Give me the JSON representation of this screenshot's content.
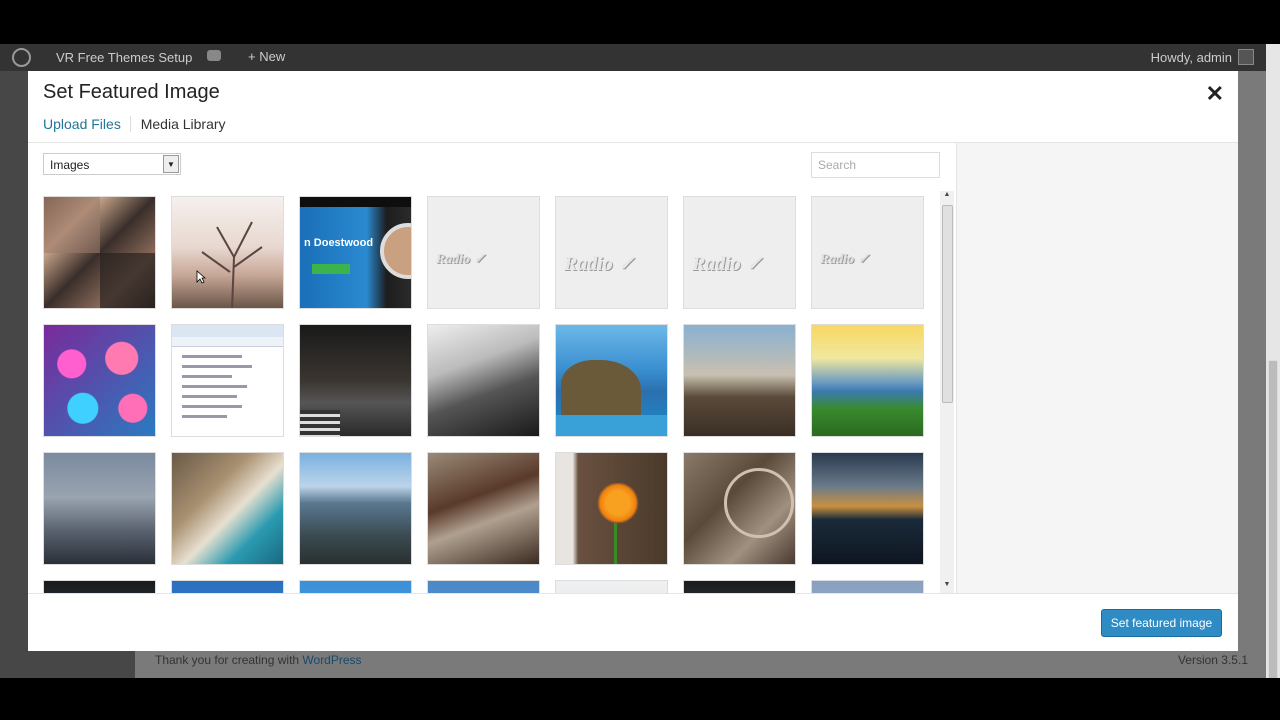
{
  "adminbar": {
    "site_name": "VR Free Themes Setup",
    "new_label": "+ New",
    "howdy": "Howdy, admin"
  },
  "footer": {
    "thanks_prefix": "Thank you for creating with ",
    "thanks_link": "WordPress",
    "version": "Version 3.5.1"
  },
  "modal": {
    "title": "Set Featured Image",
    "close_icon": "close-icon",
    "tabs": [
      {
        "label": "Upload Files"
      },
      {
        "label": "Media Library"
      }
    ],
    "filter": {
      "selected": "Images"
    },
    "search": {
      "placeholder": "Search"
    },
    "thumbnails_visible_rows": 4,
    "thumbnails_per_row": 7,
    "primary_button": "Set featured image"
  },
  "thumb_watermark_text": "Radio ✓",
  "thumb_site_text": "n Doestwood",
  "colors": {
    "link": "#21759b",
    "button": "#2e8bc4",
    "adminbar": "#333333"
  }
}
